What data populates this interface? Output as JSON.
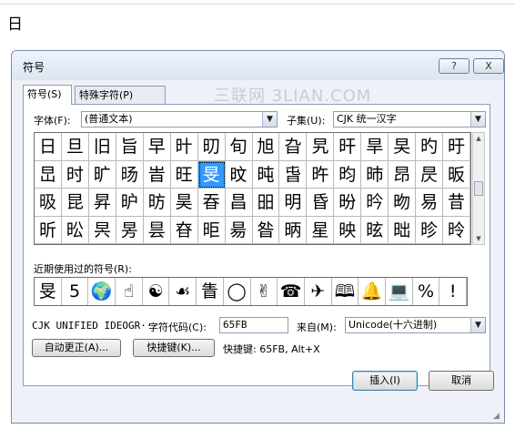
{
  "document": {
    "char": "日"
  },
  "dialog": {
    "title": "符号",
    "help_label": "?",
    "close_label": "X"
  },
  "watermark": "三联网 3LIAN.COM",
  "tabs": [
    {
      "label": "符号(S)",
      "active": true
    },
    {
      "label": "特殊字符(P)",
      "active": false
    }
  ],
  "font": {
    "label": "字体(F):",
    "value": "(普通文本)"
  },
  "subset": {
    "label": "子集(U):",
    "value": "CJK 统一汉字"
  },
  "grid": {
    "rows": [
      [
        "日",
        "旦",
        "旧",
        "旨",
        "早",
        "旪",
        "旫",
        "旬",
        "旭",
        "旮",
        "旯",
        "旰",
        "旱",
        "旲",
        "旳",
        "旴"
      ],
      [
        "旵",
        "时",
        "旷",
        "旸",
        "旹",
        "旺",
        "旻",
        "旼",
        "旽",
        "旾",
        "旿",
        "昀",
        "昁",
        "昂",
        "昃",
        "昄"
      ],
      [
        "昅",
        "昆",
        "昇",
        "昈",
        "昉",
        "昊",
        "昋",
        "昌",
        "昍",
        "明",
        "昏",
        "昐",
        "昑",
        "昒",
        "易",
        "昔"
      ],
      [
        "昕",
        "昖",
        "昗",
        "昘",
        "昙",
        "昚",
        "昛",
        "昜",
        "昝",
        "昞",
        "星",
        "映",
        "昡",
        "昢",
        "昣",
        "昤"
      ]
    ],
    "selected_row": 1,
    "selected_col": 6
  },
  "recent": {
    "label": "近期使用过的符号(R):",
    "symbols": [
      "旻",
      "5",
      "🌍",
      "☝",
      "☯",
      "☙",
      "眚",
      "◯",
      "✌",
      "☎",
      "✈",
      "🕮",
      "🔔",
      "💻",
      "%",
      "!"
    ]
  },
  "char_name": "CJK UNIFIED IDEOGR···",
  "char_code": {
    "label": "字符代码(C):",
    "value": "65FB"
  },
  "from": {
    "label": "来自(M):",
    "value": "Unicode(十六进制)"
  },
  "autocorrect_button": "自动更正(A)...",
  "shortcut_key_button": "快捷键(K)...",
  "shortcut_key_text": "快捷键: 65FB, Alt+X",
  "insert_button": "插入(I)",
  "cancel_button": "取消",
  "colors": {
    "selection": "#3399ff",
    "dialog_bg": "#eef1f7"
  }
}
